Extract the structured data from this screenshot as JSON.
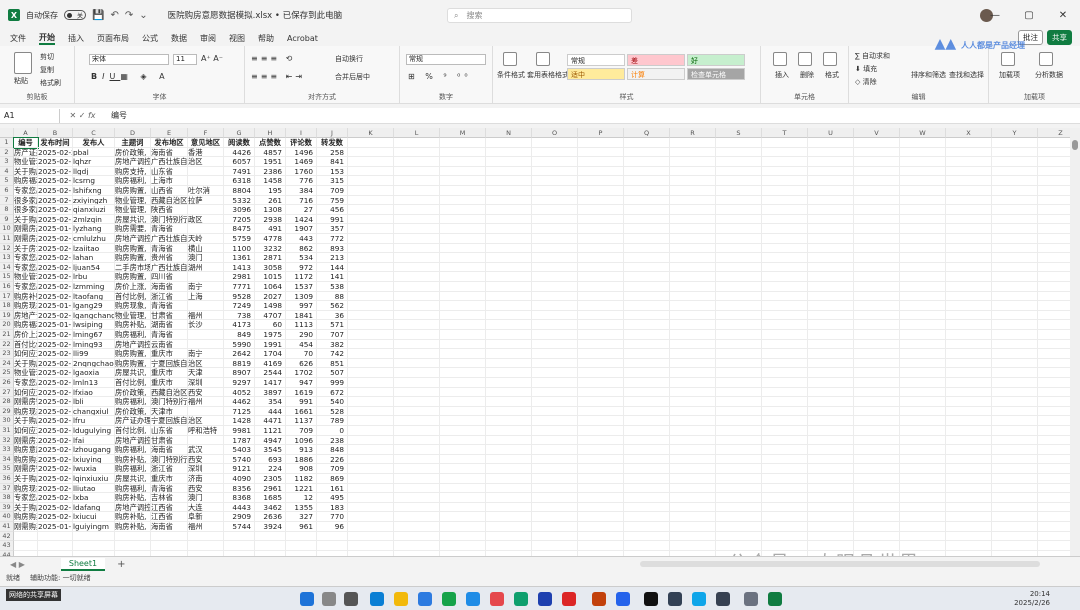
{
  "window": {
    "autosave_label": "自动保存",
    "autosave_state": "关",
    "file_title": "医院购房意愿数据模拟.xlsx • 已保存到此电脑",
    "search_placeholder": "搜索",
    "controls": [
      "—",
      "▢",
      "✕"
    ]
  },
  "menu": [
    "文件",
    "开始",
    "插入",
    "页面布局",
    "公式",
    "数据",
    "审阅",
    "视图",
    "帮助",
    "Acrobat"
  ],
  "menu_active": "开始",
  "share": {
    "comment": "批注",
    "share": "共享"
  },
  "ribbon": {
    "clipboard": {
      "paste": "粘贴",
      "cut": "剪切",
      "copy": "复制",
      "format_painter": "格式刷",
      "label": "剪贴板"
    },
    "font": {
      "name": "宋体",
      "size": "11",
      "label": "字体"
    },
    "alignment": {
      "wrap": "自动换行",
      "merge": "合并后居中",
      "label": "对齐方式"
    },
    "number": {
      "format": "常规",
      "percent": "%",
      "label": "数字"
    },
    "styles": {
      "conditional": "条件格式",
      "table": "套用表格格式",
      "normal": "常规",
      "bad": "差",
      "good": "好",
      "neutral": "适中",
      "calc": "计算",
      "check": "检查单元格",
      "label": "样式"
    },
    "cells": {
      "insert": "插入",
      "delete": "删除",
      "format": "格式",
      "label": "单元格"
    },
    "editing": {
      "autosum": "自动求和",
      "fill": "填充",
      "clear": "清除",
      "sort": "排序和筛选",
      "find": "查找和选择",
      "label": "编辑"
    },
    "addins": {
      "addin": "加载项",
      "analyze": "分析数据",
      "label": "加载项"
    }
  },
  "formula": {
    "cell_ref": "A1",
    "fx": "fx",
    "value": "编号"
  },
  "columns": [
    "A",
    "B",
    "C",
    "D",
    "E",
    "F",
    "G",
    "H",
    "I",
    "J",
    "K",
    "L",
    "M",
    "N",
    "O",
    "P",
    "Q",
    "R",
    "S",
    "T",
    "U",
    "V",
    "W",
    "X",
    "Y",
    "Z"
  ],
  "headers": [
    "编号",
    "发布时间",
    "发布人",
    "主题词",
    "发布地区",
    "意见地区",
    "阅读数",
    "点赞数",
    "评论数",
    "转发数"
  ],
  "rows": [
    [
      "房产证办理",
      "2025-02-2",
      "pbal",
      "房价政策,",
      "海南省",
      "香港",
      "4426",
      "4857",
      "1496",
      "258"
    ],
    [
      "物业管理问",
      "2025-02-",
      "lqhzr",
      "房地产调控",
      "广西壮族自",
      "治区",
      "6057",
      "1951",
      "1469",
      "841"
    ],
    [
      "关于购房补",
      "2025-02-",
      "llgdj",
      "购房支持,",
      "山东省",
      "",
      "7491",
      "2386",
      "1760",
      "153"
    ],
    [
      "购房福利问",
      "2025-02-",
      "lcsrng",
      "购房福利,",
      "上海市",
      "",
      "6318",
      "1458",
      "776",
      "315"
    ],
    [
      "专家您出,",
      "2025-02-",
      "lshifxng",
      "购房购置,",
      "山西省",
      "吐尔消",
      "8804",
      "195",
      "384",
      "709"
    ],
    [
      "很多家庭住",
      "2025-02-",
      "zxiyingzh",
      "物业管理,",
      "西藏自治区",
      "拉萨",
      "5332",
      "261",
      "716",
      "759"
    ],
    [
      "很多家庭住",
      "2025-02-",
      "qianxiuzi",
      "物业管理,",
      "陕西省",
      "",
      "3096",
      "1308",
      "27",
      "456"
    ],
    [
      "关于购房补",
      "2025-02-",
      "2mlzqin",
      "房屋共识,",
      "澳门特别行",
      "政区",
      "7205",
      "2938",
      "1424",
      "991"
    ],
    [
      "刚需房产售",
      "2025-01-",
      "lyzhang",
      "购房需要,",
      "青海省",
      "",
      "8475",
      "491",
      "1907",
      "357"
    ],
    [
      "刚需房产售",
      "2025-02-",
      "cmlulzhu",
      "房地产调控",
      "广西壮族自",
      "天岭",
      "5759",
      "4778",
      "443",
      "772"
    ],
    [
      "关于房地产",
      "2025-02-",
      "lzaiitao",
      "购房购置,",
      "青海省",
      "横山",
      "1100",
      "3232",
      "862",
      "893"
    ],
    [
      "专家您出,",
      "2025-02-",
      "lahan",
      "购房购置,",
      "贵州省",
      "澳门",
      "1361",
      "2871",
      "534",
      "213"
    ],
    [
      "专家您出,",
      "2025-02-",
      "ljuan54",
      "二手房市场",
      "广西壮族自",
      "湖州",
      "1413",
      "3058",
      "972",
      "144"
    ],
    [
      "物业管理问",
      "2025-02-",
      "lrbu",
      "购房购置,",
      "四川省",
      "",
      "2981",
      "1015",
      "1172",
      "141"
    ],
    [
      "专家您出,",
      "2025-02-",
      "lzmming",
      "房价上涨,",
      "海南省",
      "南宁",
      "7771",
      "1064",
      "1537",
      "538"
    ],
    [
      "购房补贴政",
      "2025-02-",
      "ltaofang",
      "首付比例,",
      "浙江省",
      "上海",
      "9528",
      "2027",
      "1309",
      "88"
    ],
    [
      "购房现象,",
      "2025-01-",
      "lgang29",
      "购房现象,",
      "青海省",
      "",
      "7249",
      "1498",
      "997",
      "562"
    ],
    [
      "房地产调控",
      "2025-02-",
      "lgangchang",
      "物业管理,",
      "甘肃省",
      "福州",
      "738",
      "4707",
      "1841",
      "36"
    ],
    [
      "购房福利问",
      "2025-01-",
      "lwsiping",
      "购房补贴,",
      "湖南省",
      "长沙",
      "4173",
      "60",
      "1113",
      "571"
    ],
    [
      "房价上涨问",
      "2025-02-",
      "lming67",
      "购房福利,",
      "青海省",
      "",
      "849",
      "1975",
      "290",
      "707"
    ],
    [
      "首付比例问",
      "2025-02-",
      "lming93",
      "房地产调控",
      "云南省",
      "",
      "5990",
      "1991",
      "454",
      "382"
    ],
    [
      "如何应对房",
      "2025-02-",
      "lli99",
      "购房购置,",
      "重庆市",
      "南宁",
      "2642",
      "1704",
      "70",
      "742"
    ],
    [
      "关于购房补",
      "2025-02-",
      "2nqngchao",
      "购房购置,",
      "宁夏回族自",
      "治区",
      "8819",
      "4169",
      "626",
      "851"
    ],
    [
      "物业管理问",
      "2025-02-",
      "lgaoxia",
      "房屋共识,",
      "重庆市",
      "天津",
      "8907",
      "2544",
      "1702",
      "507"
    ],
    [
      "专家您出,",
      "2025-02-",
      "lmln13",
      "首付比例,",
      "重庆市",
      "深圳",
      "9297",
      "1417",
      "947",
      "999"
    ],
    [
      "如何应对房",
      "2025-02-",
      "lfxiao",
      "房价政策,",
      "西藏自治区",
      "西安",
      "4052",
      "3897",
      "1619",
      "672"
    ],
    [
      "刚需房需要",
      "2025-02-",
      "lbli",
      "购房福利,",
      "澳门特别行",
      "福州",
      "4462",
      "354",
      "991",
      "540"
    ],
    [
      "购房现象问",
      "2025-02-",
      "changxiul",
      "房价政策,",
      "天津市",
      "",
      "7125",
      "444",
      "1661",
      "528"
    ],
    [
      "关于购房补",
      "2025-02-",
      "lfru",
      "房产证办理",
      "宁夏回族自",
      "治区",
      "1428",
      "4471",
      "1137",
      "789"
    ],
    [
      "如何应对购",
      "2025-02-",
      "ldugulying",
      "首付比例,",
      "山东省",
      "呼和浩特",
      "9981",
      "1121",
      "709",
      "0"
    ],
    [
      "刚需房地产",
      "2025-02-",
      "lfai",
      "房地产调控",
      "甘肃省",
      "",
      "1787",
      "4947",
      "1096",
      "238"
    ],
    [
      "购房意愿问",
      "2025-02-",
      "lzhougang",
      "购房福利,",
      "海南省",
      "武汉",
      "5403",
      "3545",
      "913",
      "848"
    ],
    [
      "购房购买问",
      "2025-02-",
      "lxiuying",
      "购房补贴,",
      "澳门特别行",
      "西安",
      "5740",
      "693",
      "1886",
      "226"
    ],
    [
      "刚需房需要",
      "2025-02-",
      "lwuxia",
      "购房福利,",
      "浙江省",
      "深圳",
      "9121",
      "224",
      "908",
      "709"
    ],
    [
      "关于购房补",
      "2025-02-",
      "lqinxiuxiu",
      "房屋共识,",
      "重庆市",
      "济南",
      "4090",
      "2305",
      "1182",
      "869"
    ],
    [
      "购房现象问",
      "2025-02-",
      "lliutao",
      "购房福利,",
      "青海省",
      "西安",
      "8356",
      "2961",
      "1221",
      "161"
    ],
    [
      "专家您出,",
      "2025-02-",
      "lxba",
      "购房补贴,",
      "吉林省",
      "澳门",
      "8368",
      "1685",
      "12",
      "495"
    ],
    [
      "关于购房补",
      "2025-02-",
      "ldafang",
      "房地产调控",
      "江西省",
      "大连",
      "4443",
      "3462",
      "1355",
      "183"
    ],
    [
      "购房购买问",
      "2025-02-",
      "lxiucui",
      "购房补贴,",
      "江西省",
      "阜新",
      "2909",
      "2636",
      "327",
      "770"
    ],
    [
      "刚需购买问",
      "2025-01-",
      "lguiyingm",
      "购房补贴,",
      "海南省",
      "福州",
      "5744",
      "3924",
      "961",
      "96"
    ]
  ],
  "sheet": {
    "tab": "Sheet1",
    "add": "+"
  },
  "status": {
    "ready": "就绪",
    "accessibility": "辅助功能: 一切就绪"
  },
  "taskbar": {
    "notification": "网络的共享屏幕",
    "time": "20:14",
    "date": "2025/2/26"
  },
  "watermark": {
    "text": "公众号 · 肉眼品世界",
    "logo": "人人都是产品经理"
  }
}
